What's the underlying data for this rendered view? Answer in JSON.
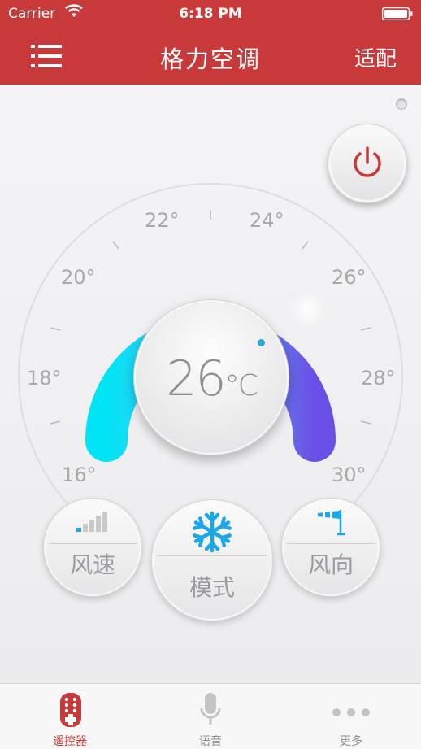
{
  "status": {
    "carrier": "Carrier",
    "time": "6:18 PM"
  },
  "nav": {
    "title": "格力空调",
    "right_label": "适配",
    "menu_icon": "list-icon"
  },
  "dial": {
    "scale_labels": [
      "16°",
      "18°",
      "20°",
      "22°",
      "24°",
      "26°",
      "28°",
      "30°"
    ],
    "arc_colors": [
      "#00e5f5",
      "#6a4fe6"
    ]
  },
  "temperature": {
    "value": "26",
    "unit": "°C"
  },
  "controls": {
    "fan_speed_label": "风速",
    "mode_label": "模式",
    "direction_label": "风向"
  },
  "tabs": [
    {
      "label": "遥控器",
      "icon": "remote-icon",
      "active": true
    },
    {
      "label": "语音",
      "icon": "microphone-icon",
      "active": false
    },
    {
      "label": "更多",
      "icon": "more-icon",
      "active": false
    }
  ],
  "colors": {
    "brand": "#c8393a",
    "power": "#c8393a",
    "snowflake": "#1ca8e8"
  }
}
